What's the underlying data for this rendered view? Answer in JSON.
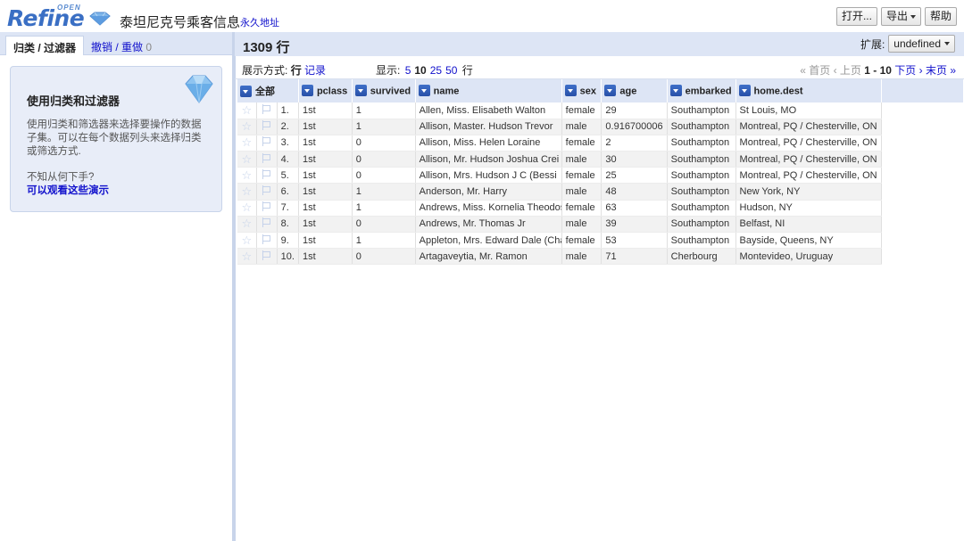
{
  "header": {
    "logo_text": "Refine",
    "logo_small": "OPEN",
    "project_title": "泰坦尼克号乘客信息",
    "permalink": "永久地址",
    "buttons": {
      "open": "打开...",
      "export": "导出",
      "help": "帮助"
    }
  },
  "left": {
    "tabs": {
      "facets": "归类 / 过滤器",
      "undo": "撤销 / 重做",
      "undo_count": "0"
    },
    "help": {
      "title": "使用归类和过滤器",
      "desc": "使用归类和筛选器来选择要操作的数据子集。可以在每个数据列头来选择归类或筛选方式.",
      "question": "不知从何下手?",
      "demo_link": "可以观看这些演示"
    }
  },
  "summary": {
    "row_count": "1309 行",
    "extension_label": "扩展:",
    "extension_value": "undefined"
  },
  "view": {
    "mode_label": "展示方式:",
    "mode_rows": "行",
    "mode_records": "记录",
    "show_label": "显示:",
    "sizes": [
      "5",
      "10",
      "25",
      "50"
    ],
    "rows_suffix": "行",
    "pager": {
      "first": "« 首页",
      "prev": "‹ 上页",
      "range": "1 - 10",
      "next": "下页 ›",
      "last": "末页 »"
    }
  },
  "table": {
    "all_label": "全部",
    "columns": [
      "pclass",
      "survived",
      "name",
      "sex",
      "age",
      "embarked",
      "home.dest"
    ],
    "rows": [
      [
        "1.",
        "1st",
        "1",
        "Allen, Miss. Elisabeth Walton",
        "female",
        "29",
        "Southampton",
        "St Louis, MO"
      ],
      [
        "2.",
        "1st",
        "1",
        "Allison, Master. Hudson Trevor",
        "male",
        "0.916700006",
        "Southampton",
        "Montreal, PQ / Chesterville, ON"
      ],
      [
        "3.",
        "1st",
        "0",
        "Allison, Miss. Helen Loraine",
        "female",
        "2",
        "Southampton",
        "Montreal, PQ / Chesterville, ON"
      ],
      [
        "4.",
        "1st",
        "0",
        "Allison, Mr. Hudson Joshua Crei",
        "male",
        "30",
        "Southampton",
        "Montreal, PQ / Chesterville, ON"
      ],
      [
        "5.",
        "1st",
        "0",
        "Allison, Mrs. Hudson J C (Bessi",
        "female",
        "25",
        "Southampton",
        "Montreal, PQ / Chesterville, ON"
      ],
      [
        "6.",
        "1st",
        "1",
        "Anderson, Mr. Harry",
        "male",
        "48",
        "Southampton",
        "New York, NY"
      ],
      [
        "7.",
        "1st",
        "1",
        "Andrews, Miss. Kornelia Theodos",
        "female",
        "63",
        "Southampton",
        "Hudson, NY"
      ],
      [
        "8.",
        "1st",
        "0",
        "Andrews, Mr. Thomas Jr",
        "male",
        "39",
        "Southampton",
        "Belfast, NI"
      ],
      [
        "9.",
        "1st",
        "1",
        "Appleton, Mrs. Edward Dale (Cha",
        "female",
        "53",
        "Southampton",
        "Bayside, Queens, NY"
      ],
      [
        "10.",
        "1st",
        "0",
        "Artagaveytia, Mr. Ramon",
        "male",
        "71",
        "Cherbourg",
        "Montevideo, Uruguay"
      ]
    ]
  }
}
